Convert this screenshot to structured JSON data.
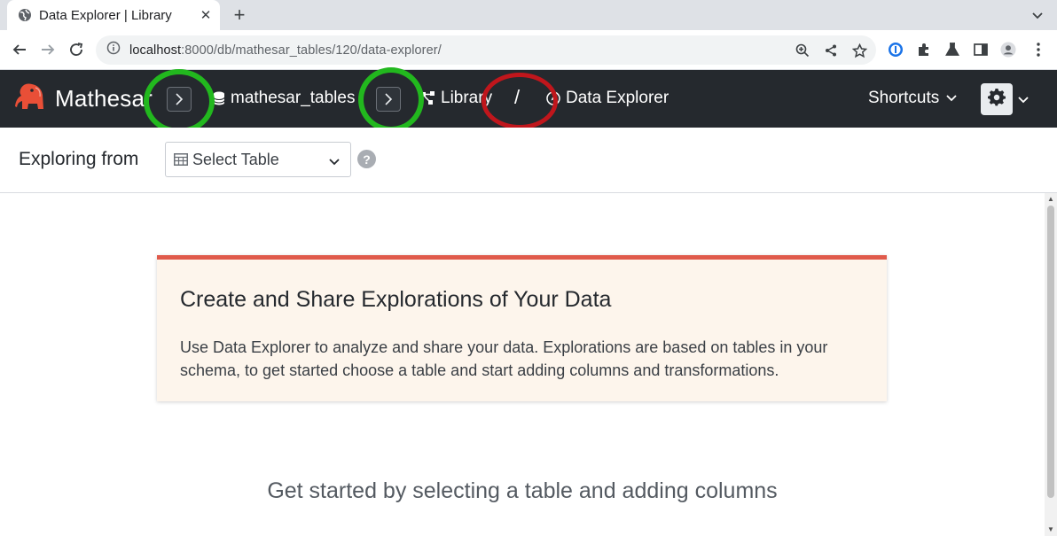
{
  "browser": {
    "tab_title": "Data Explorer | Library",
    "url_host": "localhost",
    "url_path": ":8000/db/mathesar_tables/120/data-explorer/"
  },
  "header": {
    "brand": "Mathesar",
    "crumbs": {
      "database": "mathesar_tables",
      "schema": "Library",
      "page": "Data Explorer"
    },
    "separator": "/",
    "shortcuts_label": "Shortcuts"
  },
  "explore": {
    "label": "Exploring from",
    "select_placeholder": "Select Table",
    "help": "?"
  },
  "callout": {
    "title": "Create and Share Explorations of Your Data",
    "body": "Use Data Explorer to analyze and share your data. Explorations are based on tables in your schema, to get started choose a table and start adding columns and transformations."
  },
  "empty_state": "Get started by selecting a table and adding columns",
  "colors": {
    "header_bg": "#25292e",
    "callout_accent": "#e05a4b",
    "callout_bg": "#fdf5ec",
    "annotation_green": "#22b81e",
    "annotation_red": "#c0161c"
  },
  "icons": {
    "tab_favicon": "globe-icon",
    "crumb_database": "database-icon",
    "crumb_schema": "schema-icon",
    "crumb_page": "compass-icon",
    "settings": "gear-icon",
    "select": "table-icon"
  }
}
